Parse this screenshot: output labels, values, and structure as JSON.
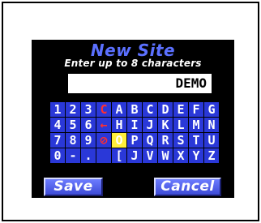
{
  "header": {
    "title": "New Site",
    "subtitle": "Enter up to 8 characters"
  },
  "entry": {
    "value": "DEMO"
  },
  "keyboard": {
    "selected_key": "O",
    "rows": [
      [
        "1",
        "2",
        "3",
        "C",
        "A",
        "B",
        "C",
        "D",
        "E",
        "F",
        "G"
      ],
      [
        "4",
        "5",
        "6",
        "←",
        "H",
        "I",
        "J",
        "K",
        "L",
        "M",
        "N"
      ],
      [
        "7",
        "8",
        "9",
        "⊘",
        "O",
        "P",
        "Q",
        "R",
        "S",
        "T",
        "U"
      ],
      [
        "0",
        "-",
        ".",
        "",
        "[",
        "J",
        "V",
        "W",
        "X",
        "Y",
        "Z"
      ]
    ]
  },
  "buttons": {
    "save_label": "Save",
    "cancel_label": "Cancel"
  },
  "colors": {
    "title": "#5b70ff",
    "key_bg": "#2a38d8",
    "key_selected_bg": "#ffef3a",
    "special_char": "#ff2f2f"
  }
}
